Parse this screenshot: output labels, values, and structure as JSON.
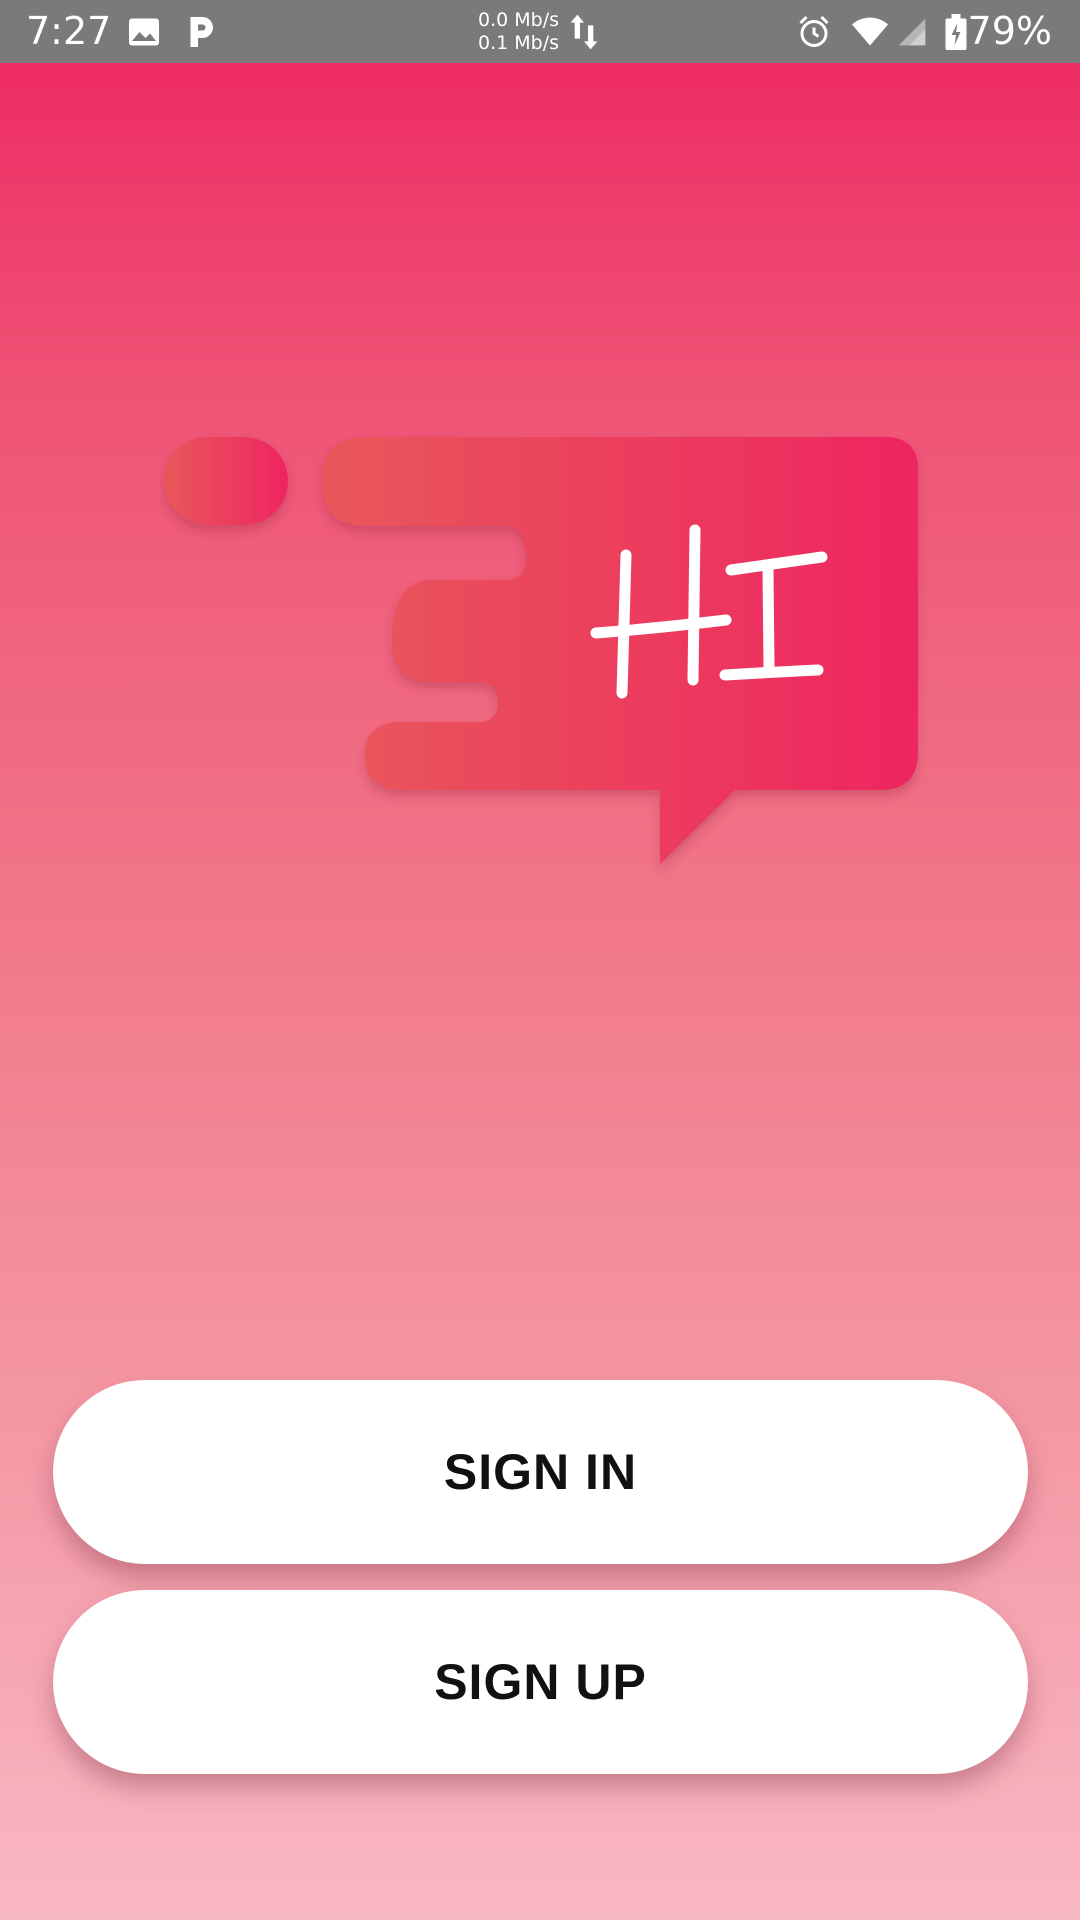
{
  "status_bar": {
    "time": "7:27",
    "net_up": "0.0 Mb/s",
    "net_down": "0.1 Mb/s",
    "battery": "79%",
    "icons": [
      "image-icon",
      "p-app-icon",
      "data-arrows-icon",
      "alarm-icon",
      "wifi-icon",
      "signal-icon",
      "battery-charging-icon"
    ]
  },
  "logo": {
    "text": "HI",
    "colors": {
      "start": "#e9585a",
      "end": "#ee2560"
    }
  },
  "actions": {
    "sign_in": "SIGN IN",
    "sign_up": "SIGN UP"
  },
  "colors": {
    "background_top": "#ee2560",
    "background_bottom": "#f8b8c3",
    "button": "#ffffff",
    "status_bar": "#7a7a7a"
  }
}
